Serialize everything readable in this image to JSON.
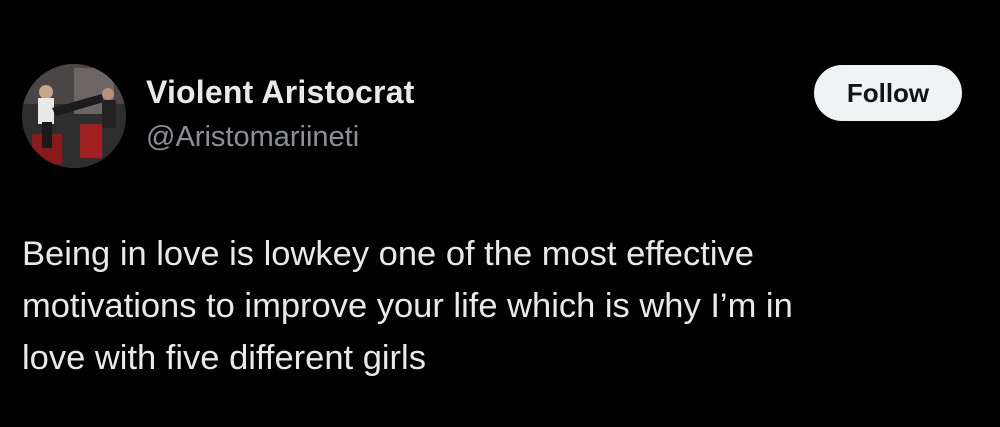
{
  "author": {
    "display_name": "Violent Aristocrat",
    "handle": "@Aristomariineti",
    "avatar_icon": "profile-photo"
  },
  "follow_button": {
    "label": "Follow"
  },
  "tweet": {
    "lines": [
      "Being in love is lowkey one of the most effective",
      "motivations to improve your life which is why I’m in",
      "love with five different girls"
    ]
  },
  "colors": {
    "background": "#000000",
    "text_primary": "#e7e9ea",
    "text_secondary": "#8b9096",
    "button_bg": "#eff3f4",
    "button_text": "#0f1419"
  }
}
